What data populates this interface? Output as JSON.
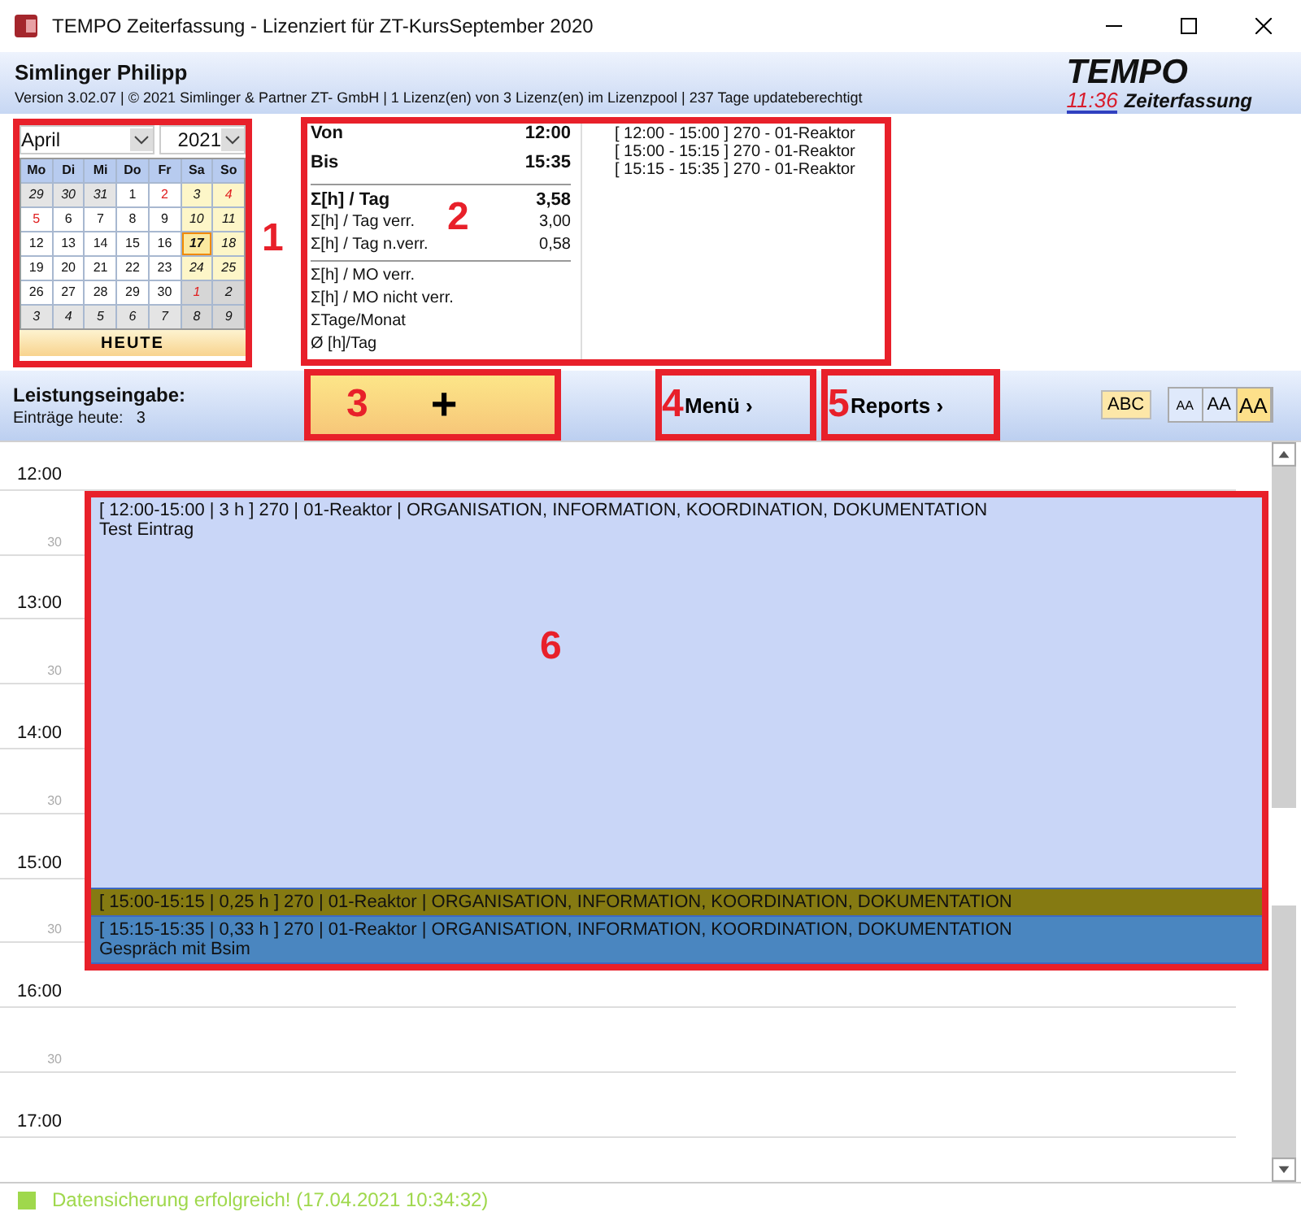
{
  "window": {
    "title": "TEMPO Zeiterfassung - Lizenziert für ZT-KursSeptember 2020"
  },
  "header": {
    "user": "Simlinger Philipp",
    "version_line": "Version 3.02.07 | © 2021 Simlinger & Partner ZT- GmbH | 1 Lizenz(en) von 3 Lizenz(en) im Lizenzpool | 237 Tage updateberechtigt",
    "logo": {
      "brand": "TEMPO",
      "clock": "11:36",
      "subtitle": "Zeiterfassung"
    }
  },
  "calendar": {
    "annotation": "1",
    "month": "April",
    "year": "2021",
    "weekdays": [
      "Mo",
      "Di",
      "Mi",
      "Do",
      "Fr",
      "Sa",
      "So"
    ],
    "today_button": "HEUTE",
    "days": [
      {
        "label": "29",
        "kind": "other",
        "weekend": false,
        "holiday": false,
        "selected": false
      },
      {
        "label": "30",
        "kind": "other",
        "weekend": false,
        "holiday": false,
        "selected": false
      },
      {
        "label": "31",
        "kind": "other",
        "weekend": false,
        "holiday": false,
        "selected": false
      },
      {
        "label": "1",
        "kind": "current",
        "weekend": false,
        "holiday": false,
        "selected": false
      },
      {
        "label": "2",
        "kind": "current",
        "weekend": false,
        "holiday": true,
        "selected": false
      },
      {
        "label": "3",
        "kind": "current",
        "weekend": true,
        "holiday": false,
        "selected": false
      },
      {
        "label": "4",
        "kind": "current",
        "weekend": true,
        "holiday": true,
        "selected": false
      },
      {
        "label": "5",
        "kind": "current",
        "weekend": false,
        "holiday": true,
        "selected": false
      },
      {
        "label": "6",
        "kind": "current",
        "weekend": false,
        "holiday": false,
        "selected": false
      },
      {
        "label": "7",
        "kind": "current",
        "weekend": false,
        "holiday": false,
        "selected": false
      },
      {
        "label": "8",
        "kind": "current",
        "weekend": false,
        "holiday": false,
        "selected": false
      },
      {
        "label": "9",
        "kind": "current",
        "weekend": false,
        "holiday": false,
        "selected": false
      },
      {
        "label": "10",
        "kind": "current",
        "weekend": true,
        "holiday": false,
        "selected": false
      },
      {
        "label": "11",
        "kind": "current",
        "weekend": true,
        "holiday": false,
        "selected": false
      },
      {
        "label": "12",
        "kind": "current",
        "weekend": false,
        "holiday": false,
        "selected": false
      },
      {
        "label": "13",
        "kind": "current",
        "weekend": false,
        "holiday": false,
        "selected": false
      },
      {
        "label": "14",
        "kind": "current",
        "weekend": false,
        "holiday": false,
        "selected": false
      },
      {
        "label": "15",
        "kind": "current",
        "weekend": false,
        "holiday": false,
        "selected": false
      },
      {
        "label": "16",
        "kind": "current",
        "weekend": false,
        "holiday": false,
        "selected": false
      },
      {
        "label": "17",
        "kind": "current",
        "weekend": true,
        "holiday": false,
        "selected": true
      },
      {
        "label": "18",
        "kind": "current",
        "weekend": true,
        "holiday": false,
        "selected": false
      },
      {
        "label": "19",
        "kind": "current",
        "weekend": false,
        "holiday": false,
        "selected": false
      },
      {
        "label": "20",
        "kind": "current",
        "weekend": false,
        "holiday": false,
        "selected": false
      },
      {
        "label": "21",
        "kind": "current",
        "weekend": false,
        "holiday": false,
        "selected": false
      },
      {
        "label": "22",
        "kind": "current",
        "weekend": false,
        "holiday": false,
        "selected": false
      },
      {
        "label": "23",
        "kind": "current",
        "weekend": false,
        "holiday": false,
        "selected": false
      },
      {
        "label": "24",
        "kind": "current",
        "weekend": true,
        "holiday": false,
        "selected": false
      },
      {
        "label": "25",
        "kind": "current",
        "weekend": true,
        "holiday": false,
        "selected": false
      },
      {
        "label": "26",
        "kind": "current",
        "weekend": false,
        "holiday": false,
        "selected": false
      },
      {
        "label": "27",
        "kind": "current",
        "weekend": false,
        "holiday": false,
        "selected": false
      },
      {
        "label": "28",
        "kind": "current",
        "weekend": false,
        "holiday": false,
        "selected": false
      },
      {
        "label": "29",
        "kind": "current",
        "weekend": false,
        "holiday": false,
        "selected": false
      },
      {
        "label": "30",
        "kind": "current",
        "weekend": false,
        "holiday": false,
        "selected": false
      },
      {
        "label": "1",
        "kind": "other",
        "weekend": true,
        "holiday": true,
        "selected": false
      },
      {
        "label": "2",
        "kind": "other",
        "weekend": true,
        "holiday": false,
        "selected": false
      },
      {
        "label": "3",
        "kind": "other",
        "weekend": false,
        "holiday": false,
        "selected": false
      },
      {
        "label": "4",
        "kind": "other",
        "weekend": false,
        "holiday": false,
        "selected": false
      },
      {
        "label": "5",
        "kind": "other",
        "weekend": false,
        "holiday": false,
        "selected": false
      },
      {
        "label": "6",
        "kind": "other",
        "weekend": false,
        "holiday": false,
        "selected": false
      },
      {
        "label": "7",
        "kind": "other",
        "weekend": false,
        "holiday": false,
        "selected": false
      },
      {
        "label": "8",
        "kind": "other",
        "weekend": true,
        "holiday": false,
        "selected": false
      },
      {
        "label": "9",
        "kind": "other",
        "weekend": true,
        "holiday": false,
        "selected": false
      }
    ]
  },
  "stats": {
    "annotation": "2",
    "groups": [
      [
        {
          "label": "Von",
          "value": "12:00",
          "kind": "head"
        },
        {
          "label": "Bis",
          "value": "15:35",
          "kind": "head"
        }
      ],
      [
        {
          "label": "Σ[h] / Tag",
          "value": "3,58",
          "kind": "total"
        },
        {
          "label": "Σ[h] / Tag verr.",
          "value": "3,00",
          "kind": "normal"
        },
        {
          "label": "Σ[h] / Tag n.verr.",
          "value": "0,58",
          "kind": "normal"
        }
      ],
      [
        {
          "label": "Σ[h] / MO verr.",
          "kind": "normal"
        },
        {
          "label": "Σ[h] / MO nicht verr.",
          "kind": "normal"
        },
        {
          "label": "ΣTage/Monat",
          "kind": "normal"
        },
        {
          "label": "Ø [h]/Tag",
          "kind": "normal"
        }
      ]
    ],
    "entries": [
      "[ 12:00 - 15:00 ]  270 - 01-Reaktor",
      "[ 15:00 - 15:15 ]  270 - 01-Reaktor",
      "[ 15:15 - 15:35 ]  270 - 01-Reaktor"
    ]
  },
  "toolbar": {
    "title": "Leistungseingabe:",
    "count_label": "Einträge heute:",
    "count": "3",
    "add_button": {
      "label": "+",
      "annotation": "3"
    },
    "menu_button": {
      "label": "Menü ›",
      "annotation": "4"
    },
    "reports_button": {
      "label": "Reports ›",
      "annotation": "5"
    },
    "abc_button": "ABC",
    "font_sizes": [
      {
        "label": "AA",
        "selected": false
      },
      {
        "label": "AA",
        "selected": false
      },
      {
        "label": "AA",
        "selected": true
      }
    ]
  },
  "timeline": {
    "annotation": "6",
    "slots": [
      {
        "label": "12:00",
        "kind": "hour"
      },
      {
        "label": "30",
        "kind": "half"
      },
      {
        "label": "13:00",
        "kind": "hour"
      },
      {
        "label": "30",
        "kind": "half"
      },
      {
        "label": "14:00",
        "kind": "hour"
      },
      {
        "label": "30",
        "kind": "half"
      },
      {
        "label": "15:00",
        "kind": "hour"
      },
      {
        "label": "30",
        "kind": "half"
      },
      {
        "label": "16:00",
        "kind": "hour"
      },
      {
        "label": "30",
        "kind": "half"
      },
      {
        "label": "17:00",
        "kind": "hour"
      }
    ],
    "entries": [
      {
        "title": "[ 12:00-15:00 | 3 h ]  270 | 01-Reaktor | ORGANISATION, INFORMATION, KOORDINATION, DOKUMENTATION",
        "note": "Test Eintrag",
        "color": "#c9d6f7"
      },
      {
        "title": "[ 15:00-15:15 | 0,25 h ]  270 | 01-Reaktor | ORGANISATION, INFORMATION, KOORDINATION, DOKUMENTATION",
        "color": "#857a12"
      },
      {
        "title": "[ 15:15-15:35 | 0,33 h ]  270 | 01-Reaktor | ORGANISATION, INFORMATION, KOORDINATION, DOKUMENTATION",
        "note": "Gespräch mit Bsim",
        "color": "#4a86c0"
      }
    ]
  },
  "status_bar": {
    "message": "Datensicherung erfolgreich! (17.04.2021 10:34:32)"
  }
}
